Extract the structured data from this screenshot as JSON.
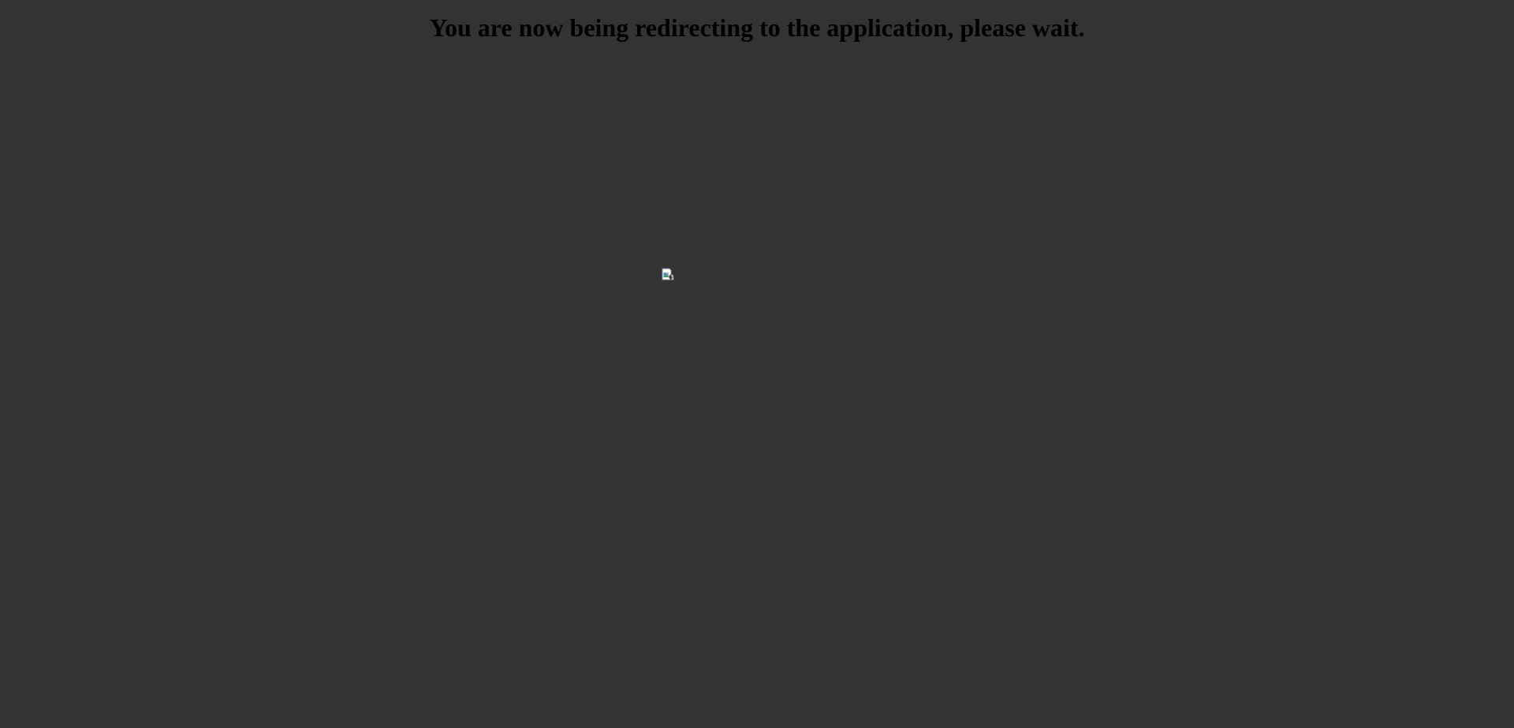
{
  "page": {
    "background_color": "#333333",
    "heading": "You are now being redirecting to the application, please wait.",
    "heading_color": "#000000",
    "loading_image": {
      "icon": "broken-image-icon"
    }
  }
}
